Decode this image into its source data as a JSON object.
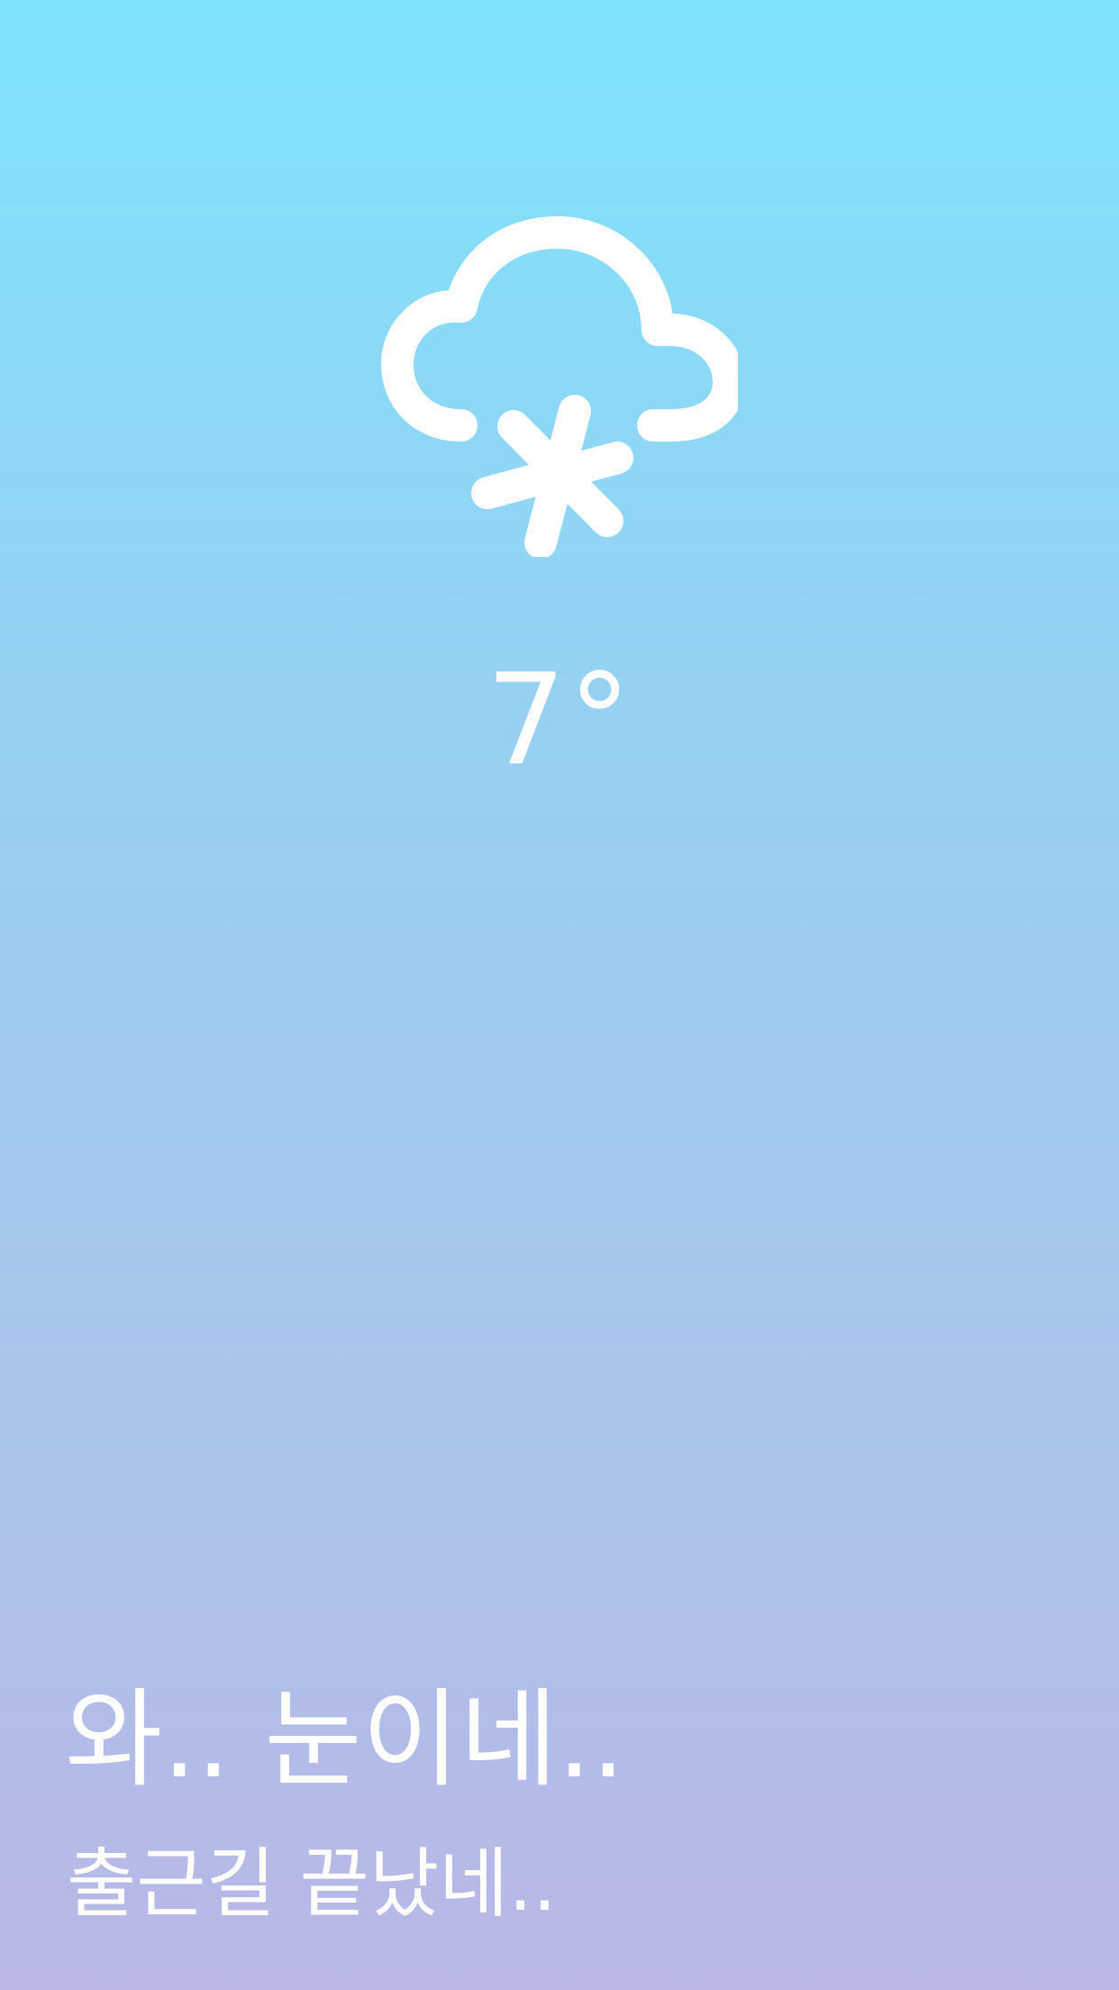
{
  "weather": {
    "icon": "snow-cloud-icon",
    "temperature": "7°"
  },
  "message": {
    "headline": "와.. 눈이네..",
    "subline": "출근길 끝났네.."
  },
  "colors": {
    "gradient_top": "#7ee3fc",
    "gradient_bottom": "#b9b7e6",
    "foreground": "#ffffff"
  }
}
